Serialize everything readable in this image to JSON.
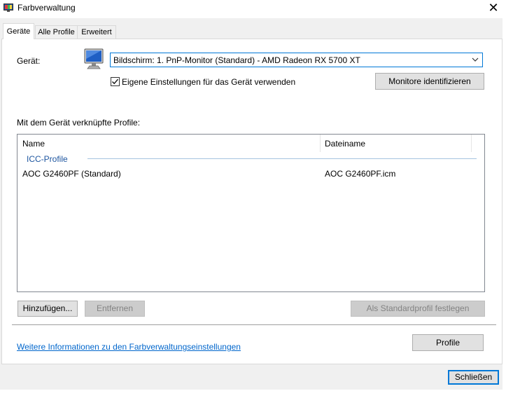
{
  "window": {
    "title": "Farbverwaltung",
    "close_glyph": "✕",
    "icon": "monitor-color-app-icon"
  },
  "tabs": [
    {
      "label": "Geräte",
      "active": true
    },
    {
      "label": "Alle Profile",
      "active": false
    },
    {
      "label": "Erweitert",
      "active": false
    }
  ],
  "device": {
    "label": "Gerät:",
    "selected": "Bildschirm: 1. PnP-Monitor (Standard) - AMD Radeon RX 5700 XT",
    "icon": "monitor-icon",
    "use_own_settings_label": "Eigene Einstellungen für das Gerät verwenden",
    "use_own_settings_checked": true,
    "identify_button": "Monitore identifizieren"
  },
  "profiles": {
    "section_label": "Mit dem Gerät verknüpfte Profile:",
    "columns": [
      "Name",
      "Dateiname"
    ],
    "group_label": "ICC-Profile",
    "rows": [
      {
        "name": "AOC G2460PF (Standard)",
        "filename": "AOC G2460PF.icm"
      }
    ]
  },
  "actions": {
    "add": "Hinzufügen...",
    "remove": "Entfernen",
    "set_default": "Als Standardprofil festlegen"
  },
  "footer": {
    "more_info_link": "Weitere Informationen zu den Farbverwaltungseinstellungen",
    "profiles_button": "Profile",
    "close_button": "Schließen"
  },
  "colors": {
    "accent": "#0078d7",
    "link": "#0066cc",
    "group_label": "#1e56a0",
    "dialog_bg": "#f0f0f0"
  }
}
